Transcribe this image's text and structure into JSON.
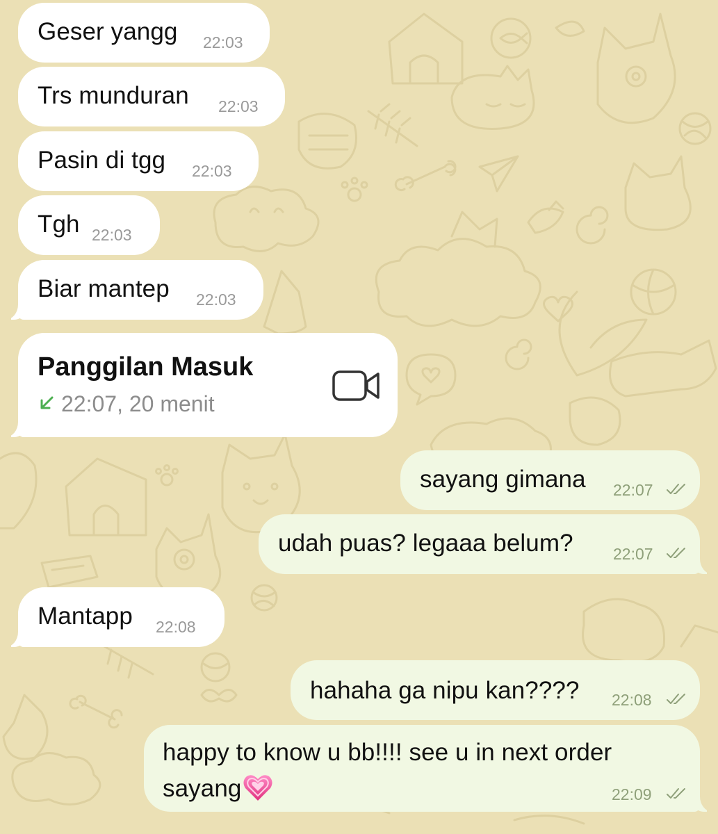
{
  "chat": {
    "messages": [
      {
        "text": "Geser yangg",
        "time": "22:03"
      },
      {
        "text": "Trs munduran",
        "time": "22:03"
      },
      {
        "text": "Pasin di tgg",
        "time": "22:03"
      },
      {
        "text": "Tgh",
        "time": "22:03"
      },
      {
        "text": "Biar mantep",
        "time": "22:03"
      },
      {
        "text": "sayang gimana",
        "time": "22:07"
      },
      {
        "text": "udah puas? legaaa belum?",
        "time": "22:07"
      },
      {
        "text": "Mantapp",
        "time": "22:08"
      },
      {
        "text": "hahaha ga nipu kan????",
        "time": "22:08"
      },
      {
        "text": "happy to know u bb!!!! see u in next order",
        "text2": "sayang",
        "time": "22:09"
      }
    ],
    "call": {
      "title": "Panggilan Masuk",
      "detail": "22:07, 20 menit",
      "direction_icon": "incoming-arrow-icon",
      "type_icon": "video-camera-icon"
    }
  },
  "icons": {
    "read_receipt": "double-check-icon",
    "emoji": "growing-heart-emoji"
  },
  "colors": {
    "wallpaper": "#ebe0b5",
    "incoming_bubble": "#ffffff",
    "outgoing_bubble": "#f1f8e3",
    "incoming_call_arrow": "#4caf50",
    "outgoing_time": "#8fa07a"
  }
}
